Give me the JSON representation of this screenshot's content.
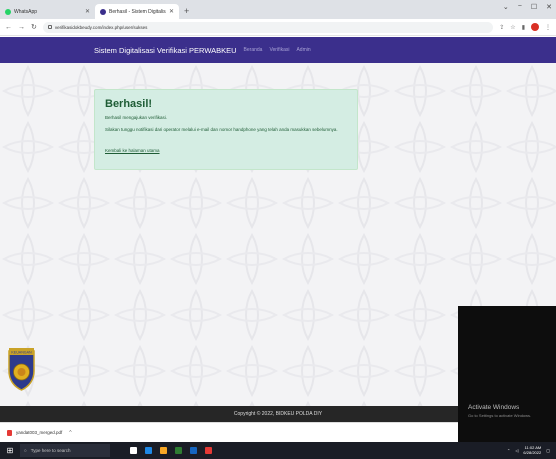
{
  "browser": {
    "tabs": [
      {
        "label": "WhatsApp",
        "active": false
      },
      {
        "label": "Berhasil - Sistem Digitalisasi Veri",
        "active": true
      }
    ],
    "new_tab": "+",
    "url": "verifikasidokbeudy.com/index.php/user/sukses",
    "window_controls": [
      "⌄",
      "−",
      "☐",
      "✕"
    ]
  },
  "navbar": {
    "brand": "Sistem Digitalisasi Verifikasi PERWABKEU",
    "links": [
      "Beranda",
      "Verifikasi",
      "Admin"
    ]
  },
  "alert": {
    "title": "Berhasil!",
    "line1": "Berhasil mengajukan verifikasi.",
    "line2": "Silakan tunggu notifikasi dari operator melalui e-mail dan nomor handphone yang telah anda masukkan sebelumnya.",
    "link": "Kembali ke halaman utama"
  },
  "emblem": {
    "label": "KEUANGAN"
  },
  "footer": {
    "text": "Copyright © 2022, BIDKEU POLDA DIY"
  },
  "windows_activation": {
    "title": "Activate Windows",
    "subtitle": "Go to Settings to activate Windows."
  },
  "download": {
    "file": "yandat003_merged.pdf",
    "chevron": "^"
  },
  "taskbar": {
    "search_placeholder": "Type here to search",
    "time": "11:02 AM",
    "date": "6/28/2022"
  },
  "colors": {
    "navbar": "#3b2f8c",
    "alert_bg": "#d4ede3",
    "alert_text": "#1e5c35",
    "footer": "#262626",
    "taskbar": "#1a1d26"
  }
}
